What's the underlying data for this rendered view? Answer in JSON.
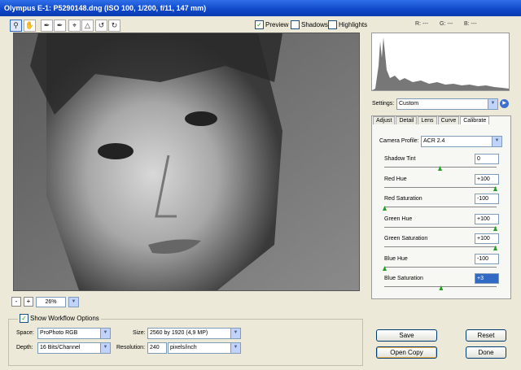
{
  "window": {
    "title": "Olympus E-1:  P5290148.dng  (ISO 100, 1/200, f/11, 147 mm)"
  },
  "toolbar": {
    "tools": [
      "zoom-icon",
      "hand-icon",
      "eyedropper-icon",
      "color-sampler-icon",
      "crop-icon",
      "straighten-icon",
      "rotate-left-icon",
      "rotate-right-icon"
    ],
    "preview_label": "Preview",
    "shadows_label": "Shadows",
    "highlights_label": "Highlights",
    "preview_checked": true,
    "shadows_checked": false,
    "highlights_checked": false
  },
  "readout": {
    "r": "R: ---",
    "g": "G: ---",
    "b": "B: ---"
  },
  "preview": {
    "zoom": "26%"
  },
  "settings": {
    "label": "Settings:",
    "value": "Custom"
  },
  "tabs": [
    "Adjust",
    "Detail",
    "Lens",
    "Curve",
    "Calibrate"
  ],
  "active_tab": "Calibrate",
  "calibrate": {
    "camera_profile_label": "Camera Profile:",
    "camera_profile_value": "ACR 2.4",
    "sliders": [
      {
        "label": "Shadow Tint",
        "value": "0",
        "position": 0.5
      },
      {
        "label": "Red Hue",
        "value": "+100",
        "position": 1.0
      },
      {
        "label": "Red Saturation",
        "value": "-100",
        "position": 0.0
      },
      {
        "label": "Green Hue",
        "value": "+100",
        "position": 1.0
      },
      {
        "label": "Green Saturation",
        "value": "+100",
        "position": 1.0
      },
      {
        "label": "Blue Hue",
        "value": "-100",
        "position": 0.0
      },
      {
        "label": "Blue Saturation",
        "value": "+3",
        "position": 0.51
      }
    ]
  },
  "workflow": {
    "show_label": "Show Workflow Options",
    "show_checked": true,
    "space_label": "Space:",
    "space_value": "ProPhoto RGB",
    "depth_label": "Depth:",
    "depth_value": "16 Bits/Channel",
    "size_label": "Size:",
    "size_value": "2560 by 1920  (4,9 MP)",
    "resolution_label": "Resolution:",
    "resolution_value": "240",
    "resolution_unit": "pixels/inch"
  },
  "buttons": {
    "save": "Save",
    "reset": "Reset",
    "open_copy": "Open Copy",
    "done": "Done"
  },
  "colors": {
    "titlebar": "#0f47c7",
    "slider_thumb": "#21a121",
    "dialog_bg": "#ece9d8"
  }
}
